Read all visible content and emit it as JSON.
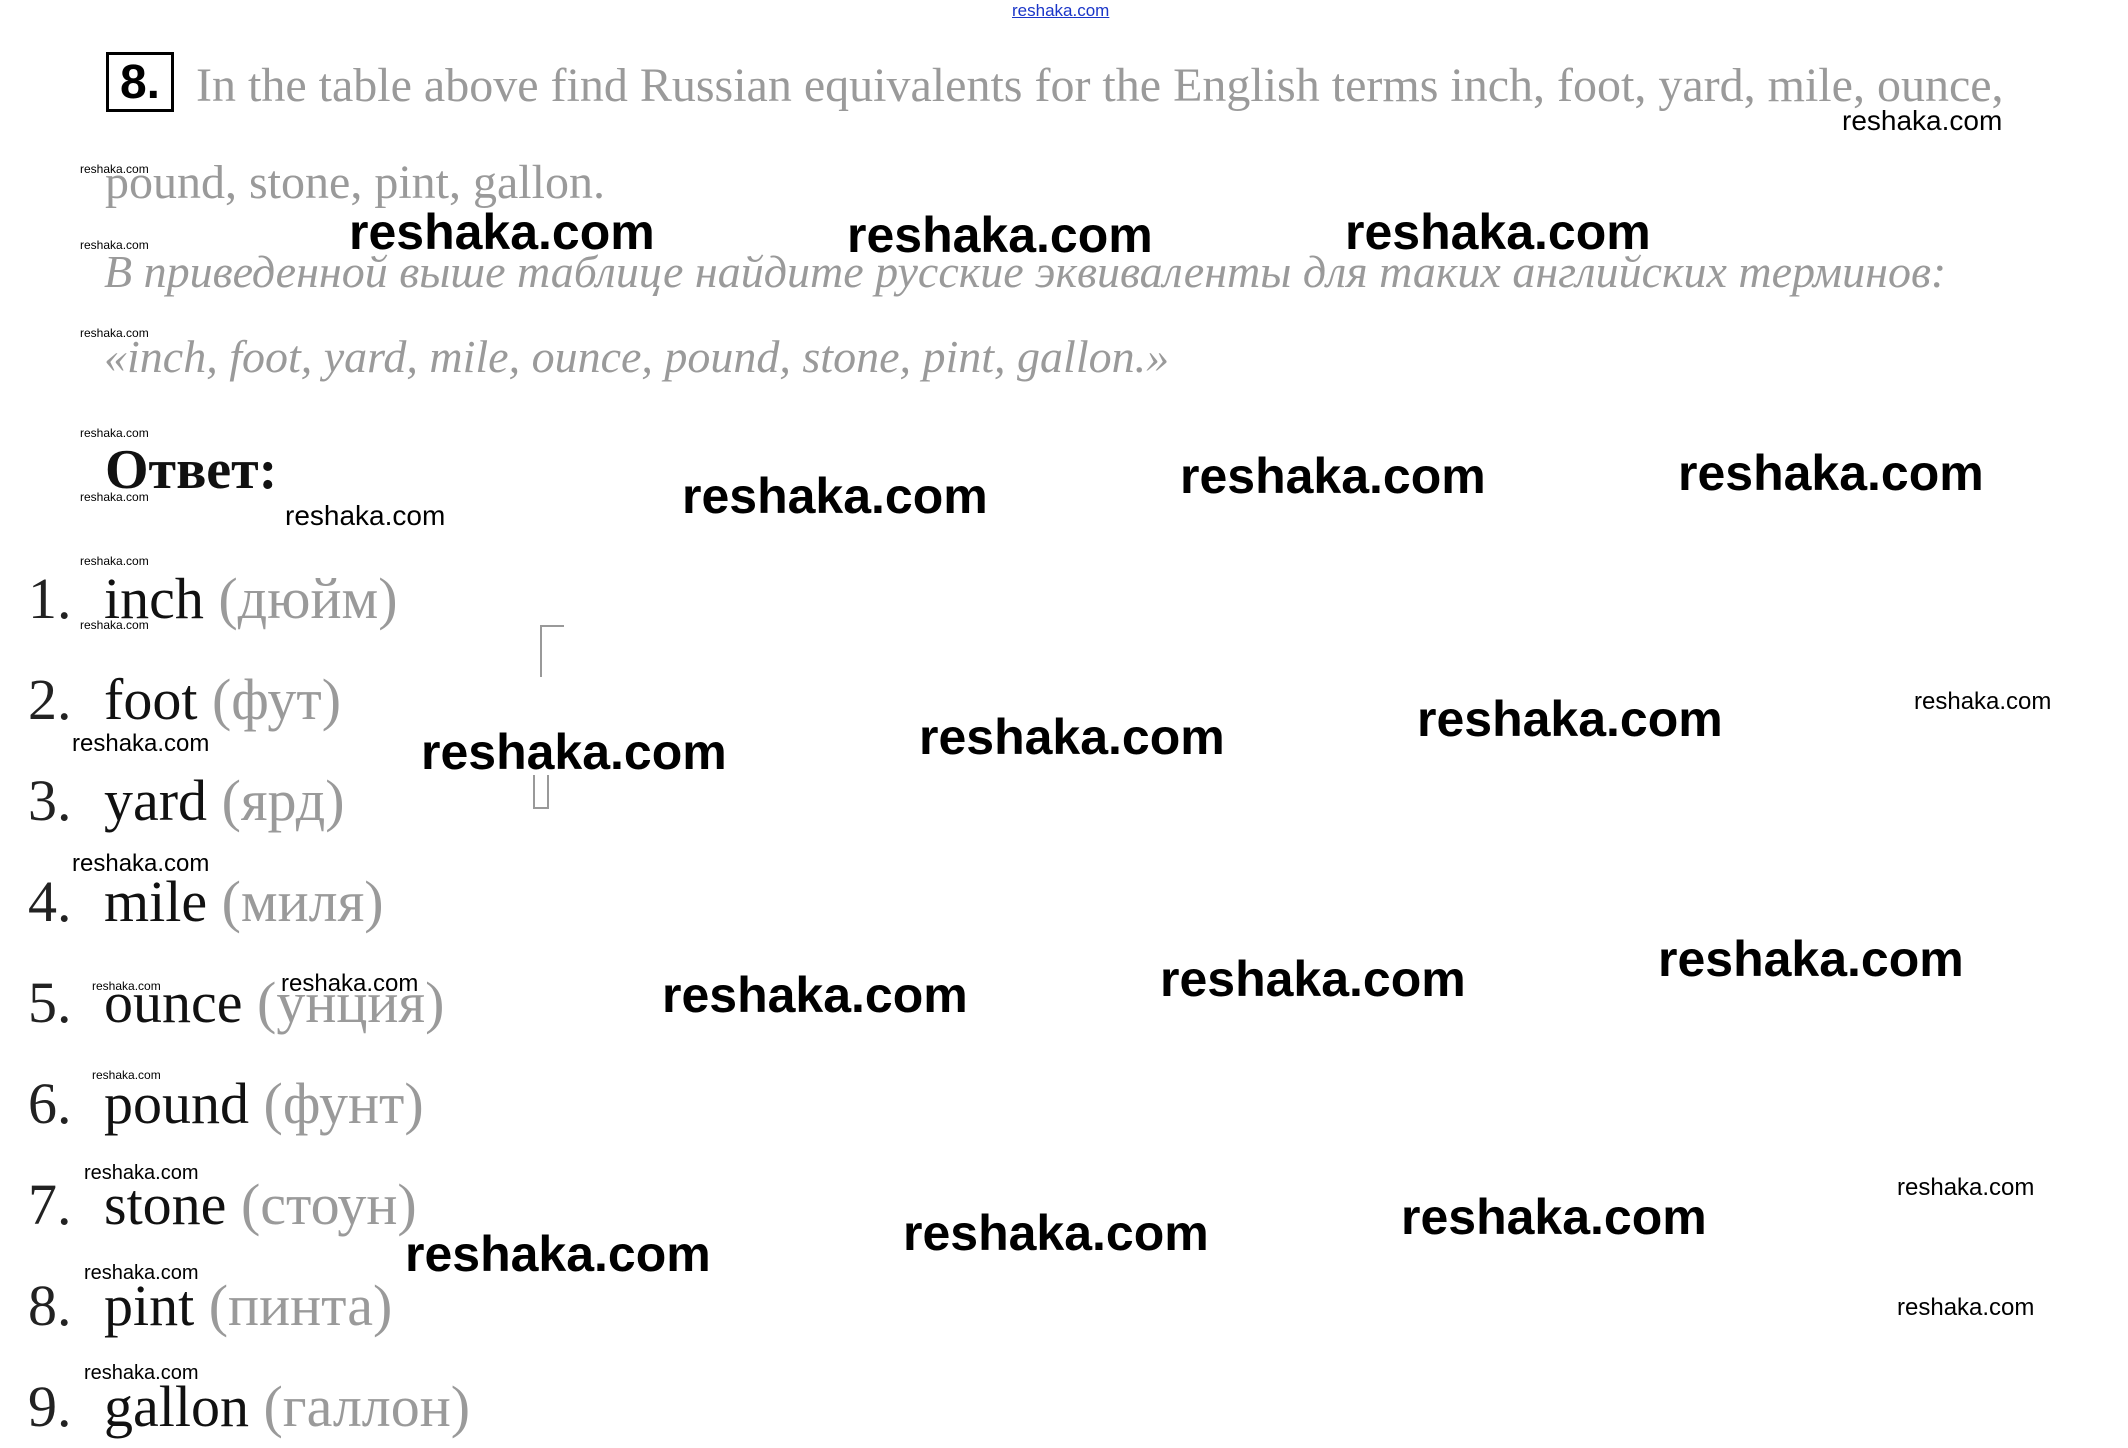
{
  "watermark": {
    "top_link": "reshaka.com",
    "text": "reshaka.com"
  },
  "task": {
    "number": "8.",
    "english_line1": "In the table above find Russian equivalents for the English terms inch, foot, yard, mile, ounce,",
    "english_line2": "pound, stone, pint, gallon.",
    "russian_line1": "В приведенной выше таблице найдите русские эквиваленты для таких английских терминов:",
    "russian_line2": "«inch, foot, yard, mile, ounce, pound, stone, pint, gallon.»"
  },
  "answer": {
    "label": "Ответ:",
    "items": [
      {
        "num": "1.",
        "term": "inch",
        "translation": "(дюйм)"
      },
      {
        "num": "2.",
        "term": "foot",
        "translation": "(фут)"
      },
      {
        "num": "3.",
        "term": "yard",
        "translation": "(ярд)"
      },
      {
        "num": "4.",
        "term": "mile",
        "translation": "(миля)"
      },
      {
        "num": "5.",
        "term": "ounce",
        "translation": "(унция)"
      },
      {
        "num": "6.",
        "term": "pound",
        "translation": "(фунт)"
      },
      {
        "num": "7.",
        "term": "stone",
        "translation": "(стоун)"
      },
      {
        "num": "8.",
        "term": "pint",
        "translation": "(пинта)"
      },
      {
        "num": "9.",
        "term": "gallon",
        "translation": "(галлон)"
      }
    ]
  }
}
